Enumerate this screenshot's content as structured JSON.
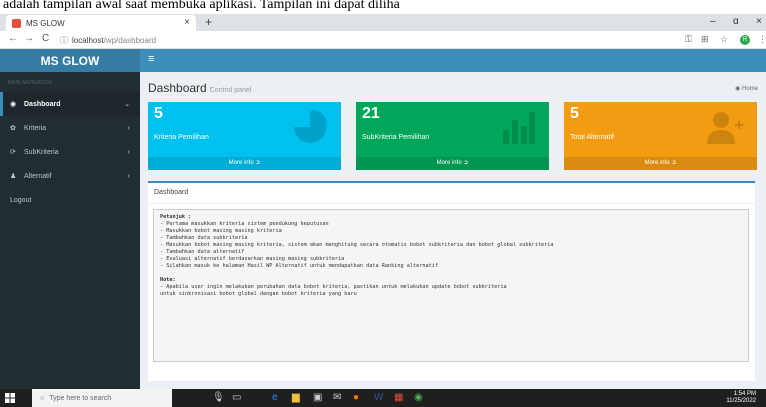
{
  "caption": "adalah tampilan awal saat membuka aplikasi. Tampilan ini dapat diliha",
  "browser": {
    "tab_title": "MS GLOW",
    "tab_close": "×",
    "new_tab": "+",
    "minimize": "–",
    "maximize": "ɑ",
    "close": "×",
    "back": "←",
    "forward": "→",
    "reload": "C",
    "url_info": "ⓘ",
    "url_host": "localhost",
    "url_path": "/wp/dashboard",
    "key_icon": "key-icon",
    "star_icon": "star-icon",
    "profile_initial": "R",
    "menu": "⋮"
  },
  "app": {
    "brand": "MS GLOW",
    "hamburger": "≡"
  },
  "sidebar": {
    "header": "MAIN NAVIGATION",
    "items": [
      {
        "label": "Dashboard",
        "icon": "dashboard-icon",
        "glyph": "◉",
        "chev": "⌄",
        "active": true
      },
      {
        "label": "Kriteria",
        "icon": "gear-icon",
        "glyph": "✿",
        "chev": "‹"
      },
      {
        "label": "SubKriteria",
        "icon": "refresh-icon",
        "glyph": "⟳",
        "chev": "‹"
      },
      {
        "label": "Alternatif",
        "icon": "user-icon",
        "glyph": "♟",
        "chev": "‹"
      },
      {
        "label": "Logout"
      }
    ]
  },
  "content": {
    "title": "Dashboard",
    "subtitle": "Control panel",
    "crumb_icon": "dashboard-icon",
    "crumb": "Home"
  },
  "boxes": [
    {
      "value": "5",
      "label": "Kriteria Pemilihan",
      "more": "More info",
      "color": "#00c0ef",
      "icon": "pie-chart-icon"
    },
    {
      "value": "21",
      "label": "SubKriteria Pemilihan",
      "more": "More info",
      "color": "#00a65a",
      "icon": "bar-chart-icon"
    },
    {
      "value": "5",
      "label": "Total Alternatif",
      "more": "More info",
      "color": "#f39c12",
      "icon": "user-plus-icon"
    }
  ],
  "panel": {
    "title": "Dashboard",
    "petunjuk_title": "Petunjuk :",
    "petunjuk": [
      "- Pertama masukkan kriteria sistem pendukung keputusan",
      "- Masukkan bobot masing masing kriteria",
      "- Tambahkan data subkriteria",
      "- Masukkan bobot masing masing kriteria, sistem akan menghitung secara otomatis bobot subkriteria dan bobot global subkriteria",
      "- Tambahkan data alternatif",
      "- Evaluasi alternatif berdasarkan masing masing subkriteria",
      "- Silahkan masuk ke halaman Hasil WP Alternatif untuk mendapatkan data Ranking alternatif"
    ],
    "note_title": "Note:",
    "note": [
      "- Apabila user ingin melakukan perubahan data bobot kriteria, pastikan untuk melakukan update bobot subkriteria",
      "untuk sinkronisasi bobot global dengan bobot kriteria yang baru"
    ]
  },
  "taskbar": {
    "search_placeholder": "Type here to search",
    "time": "1:54 PM",
    "date": "11/25/2022"
  }
}
